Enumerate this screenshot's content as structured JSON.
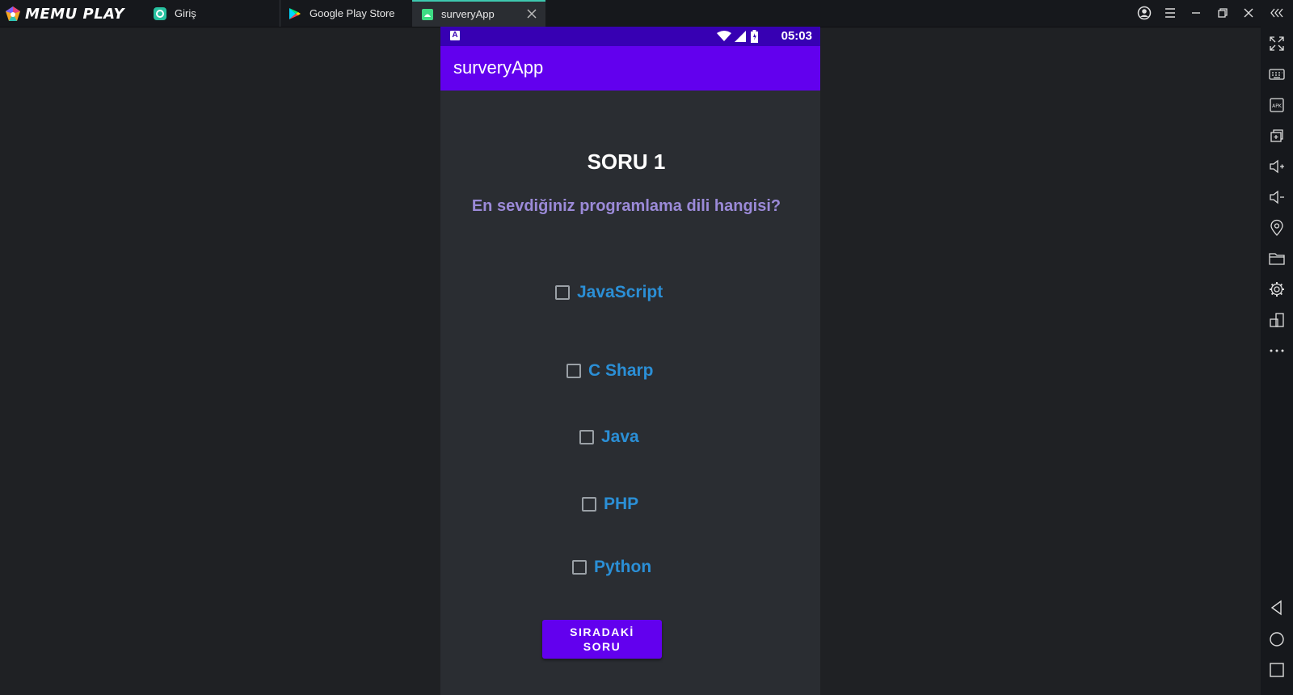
{
  "window": {
    "logo_text": "MEMU PLAY",
    "tabs": [
      {
        "label": "Giriş",
        "icon": "app-icon"
      },
      {
        "label": "Google Play Store",
        "icon": "play-store-icon"
      },
      {
        "label": "surveryApp",
        "icon": "android-app-icon",
        "active": true
      }
    ]
  },
  "status_bar": {
    "time": "05:03"
  },
  "app_bar": {
    "title": "surveryApp"
  },
  "question": {
    "number": "SORU 1",
    "text": "En sevdiğiniz programlama dili hangisi?",
    "options": [
      "JavaScript",
      "C Sharp",
      "Java",
      "PHP",
      "Python"
    ],
    "checked": [
      false,
      false,
      false,
      false,
      false
    ]
  },
  "next_button": {
    "line1": "SIRADAKİ",
    "line2": "SORU"
  },
  "colors": {
    "accent": "#6200ee",
    "status_bar": "#3700b3",
    "question_text": "#9b8ad8",
    "option_text": "#2b8fd6",
    "tab_highlight": "#3ec8b0"
  }
}
